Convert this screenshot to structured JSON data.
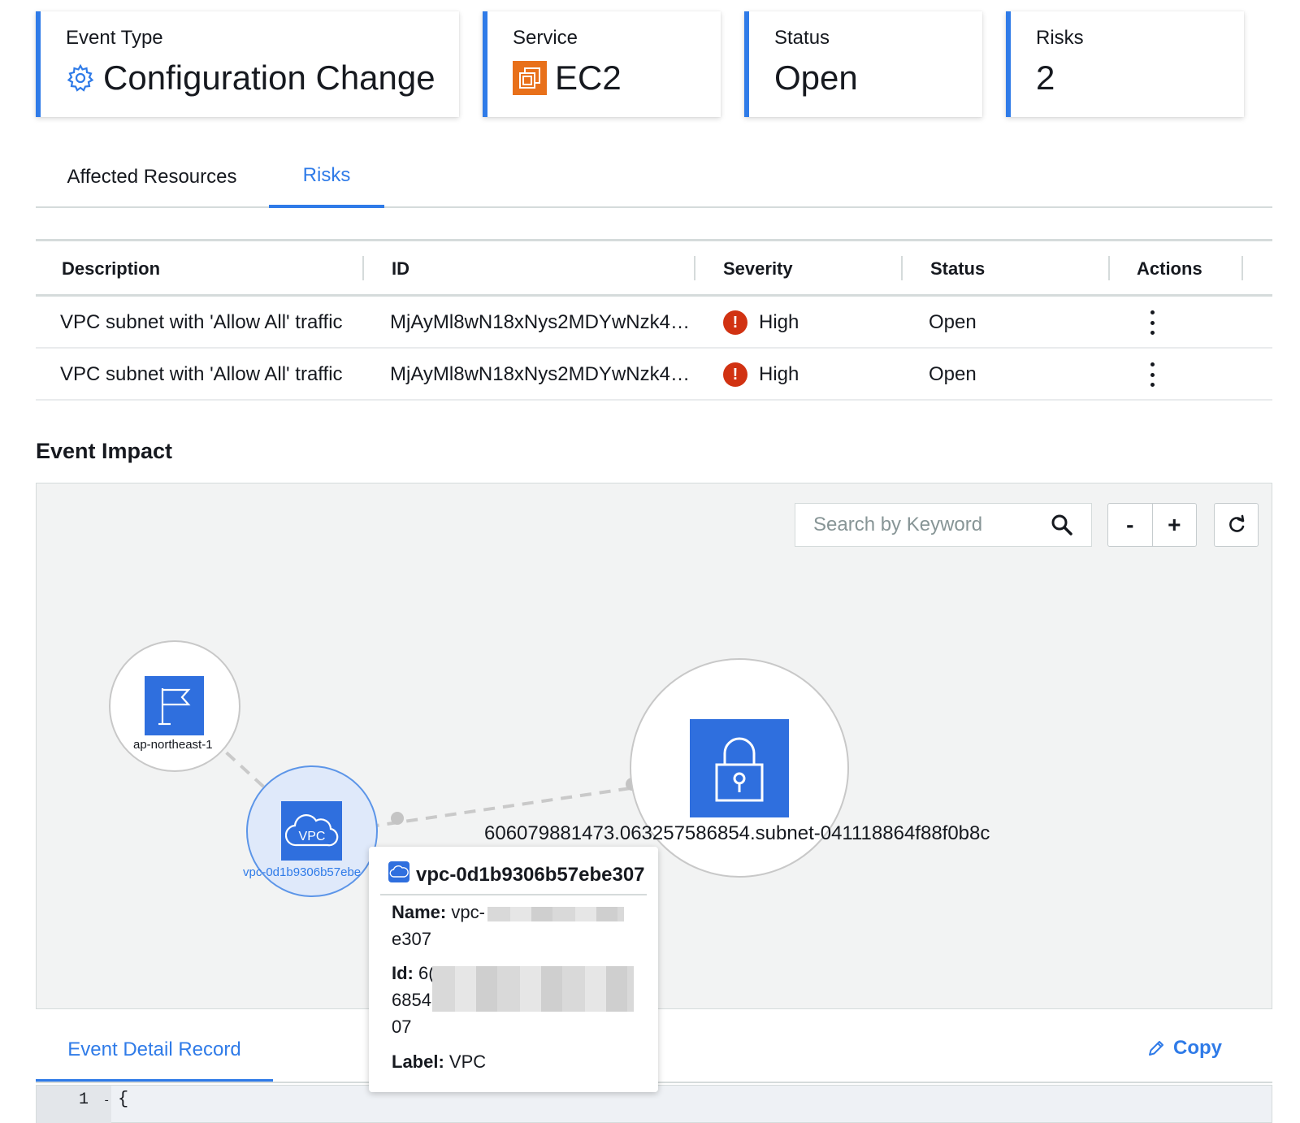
{
  "summary": {
    "event_type": {
      "label": "Event Type",
      "value": "Configuration Change",
      "icon": "gear-icon"
    },
    "service": {
      "label": "Service",
      "value": "EC2",
      "icon": "ec2-icon"
    },
    "status": {
      "label": "Status",
      "value": "Open"
    },
    "risks": {
      "label": "Risks",
      "value": "2"
    }
  },
  "tabs": [
    {
      "label": "Affected Resources",
      "active": false
    },
    {
      "label": "Risks",
      "active": true
    }
  ],
  "risk_table": {
    "columns": [
      "Description",
      "ID",
      "Severity",
      "Status",
      "Actions"
    ],
    "rows": [
      {
        "description": "VPC subnet with 'Allow All' traffic",
        "id": "MjAyMl8wN18xNys2MDYwNzk4…",
        "severity": "High",
        "status": "Open"
      },
      {
        "description": "VPC subnet with 'Allow All' traffic",
        "id": "MjAyMl8wN18xNys2MDYwNzk4…",
        "severity": "High",
        "status": "Open"
      }
    ]
  },
  "event_impact": {
    "title": "Event Impact",
    "search_placeholder": "Search by Keyword",
    "zoom_out": "-",
    "zoom_in": "+",
    "nodes": {
      "region": {
        "label": "ap-northeast-1",
        "icon": "flag-icon"
      },
      "vpc": {
        "label": "vpc-0d1b9306b57ebe",
        "icon": "vpc-cloud-icon",
        "badge": "VPC"
      },
      "subnet": {
        "label": "606079881473.063257586854.subnet-041118864f88f0b8c",
        "icon": "lock-icon"
      }
    },
    "tooltip": {
      "title": "vpc-0d1b9306b57ebe307",
      "name_key": "Name:",
      "name_value_start": "vpc-",
      "name_value_end": "e307",
      "id_key": "Id:",
      "id_value_start": "6(",
      "id_line2": "6854",
      "id_line3": "07",
      "label_key": "Label:",
      "label_value": "VPC"
    }
  },
  "detail": {
    "tab_label": "Event Detail Record",
    "copy_label": "Copy",
    "line_number": "1",
    "fold_marker": "-",
    "first_char": "{"
  },
  "colors": {
    "accent": "#2f7be8",
    "severity_high": "#d13212",
    "ec2_orange": "#e8701a",
    "node_blue": "#2f6fde"
  }
}
